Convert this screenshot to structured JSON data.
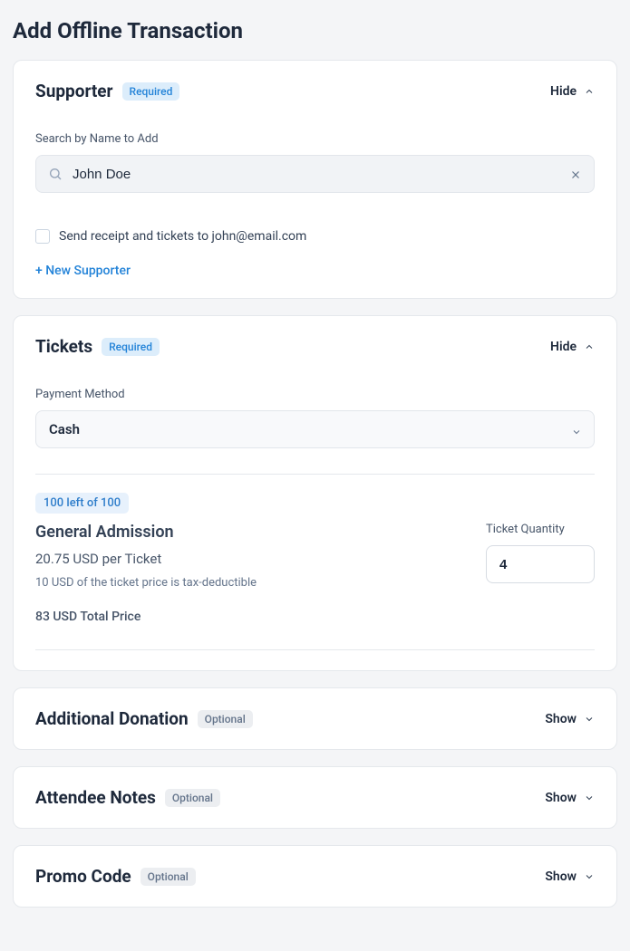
{
  "page": {
    "title": "Add Offline Transaction"
  },
  "toggle": {
    "hide": "Hide",
    "show": "Show"
  },
  "badges": {
    "required": "Required",
    "optional": "Optional"
  },
  "supporter": {
    "title": "Supporter",
    "search_label": "Search by Name to Add",
    "search_value": "John Doe",
    "receipt_label": "Send receipt and tickets to john@email.com",
    "new_supporter": "+ New Supporter"
  },
  "tickets": {
    "title": "Tickets",
    "payment_label": "Payment Method",
    "payment_value": "Cash",
    "availability": "100 left of 100",
    "name": "General Admission",
    "price_line": "20.75 USD per Ticket",
    "deductible_line": "10 USD of the ticket price is tax-deductible",
    "total_line": "83 USD Total Price",
    "qty_label": "Ticket Quantity",
    "qty_value": "4"
  },
  "additional_donation": {
    "title": "Additional Donation"
  },
  "attendee_notes": {
    "title": "Attendee Notes"
  },
  "promo_code": {
    "title": "Promo Code"
  }
}
